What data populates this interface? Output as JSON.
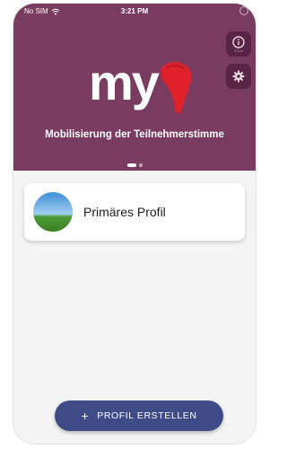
{
  "status_bar": {
    "carrier": "No SIM",
    "time": "3:21 PM"
  },
  "header": {
    "logo_text": "my",
    "subtitle": "Mobilisierung der Teilnehmerstimme",
    "info_version": "2.1.4",
    "pager": {
      "count": 2,
      "active": 1
    }
  },
  "profiles": [
    {
      "label": "Primäres Profil"
    }
  ],
  "create_button": {
    "label": "PROFIL ERSTELLEN"
  },
  "colors": {
    "header_bg": "#7a3b61",
    "icon_button_bg": "#5a2544",
    "logo_accent": "#e0202a",
    "button_bg": "#3e4b86",
    "page_bg": "#f4f4f5"
  },
  "icons": [
    "wifi-icon",
    "info-icon",
    "gear-icon",
    "plus-icon"
  ]
}
